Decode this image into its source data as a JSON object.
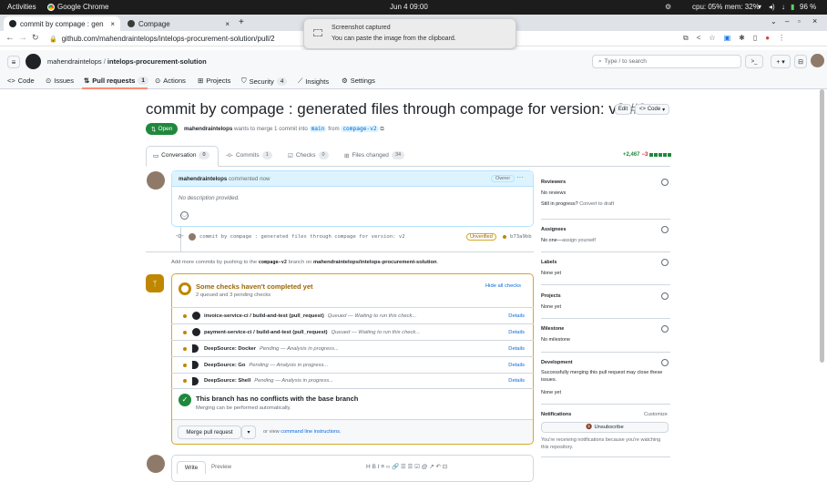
{
  "system_bar": {
    "activities": "Activities",
    "app": "Google Chrome",
    "clock": "Jun 4  09:00",
    "stats": "cpu: 05% mem: 32%",
    "battery": "96 %"
  },
  "browser": {
    "tabs": [
      {
        "title": "commit by compage : gen",
        "active": true
      },
      {
        "title": "Compage",
        "active": false
      }
    ],
    "new_tab": "+",
    "url": "github.com/mahendraintelops/intelops-procurement-solution/pull/2"
  },
  "notification": {
    "title": "Screenshot captured",
    "body": "You can paste the image from the clipboard."
  },
  "github": {
    "breadcrumb_owner": "mahendraintelops",
    "breadcrumb_sep": "/",
    "breadcrumb_repo": "intelops-procurement-solution",
    "search_placeholder": "Type / to search",
    "nav": [
      {
        "label": "Code",
        "count": null
      },
      {
        "label": "Issues",
        "count": null
      },
      {
        "label": "Pull requests",
        "count": "1"
      },
      {
        "label": "Actions",
        "count": null
      },
      {
        "label": "Projects",
        "count": null
      },
      {
        "label": "Security",
        "count": "4"
      },
      {
        "label": "Insights",
        "count": null
      },
      {
        "label": "Settings",
        "count": null
      }
    ]
  },
  "pr": {
    "title": "commit by compage : generated files through compage for version: v2",
    "number": "#2",
    "edit_label": "Edit",
    "code_label": "Code",
    "status": "Open",
    "author": "mahendraintelops",
    "merge_text": "wants to merge 1 commit into",
    "base_branch": "main",
    "from_text": "from",
    "head_branch": "compage-v2",
    "tabs": [
      {
        "label": "Conversation",
        "count": "0"
      },
      {
        "label": "Commits",
        "count": "1"
      },
      {
        "label": "Checks",
        "count": "0"
      },
      {
        "label": "Files changed",
        "count": "34"
      }
    ],
    "diffstat_add": "+2,467",
    "diffstat_del": "−3"
  },
  "comment": {
    "author": "mahendraintelops",
    "meta": "commented now",
    "role": "Owner",
    "more": "···",
    "body": "No description provided."
  },
  "commit_row": {
    "message": "commit by compage : generated files through compage for version: v2",
    "badge": "Unverified",
    "sha": "b73a9bb"
  },
  "hint": {
    "prefix": "Add more commits by pushing to the",
    "branch": "compage-v2",
    "middle": "branch on",
    "repo": "mahendraintelops/intelops-procurement-solution",
    "suffix": "."
  },
  "merge_box": {
    "checks_title": "Some checks haven't completed yet",
    "checks_subtitle": "2 queued and 3 pending checks",
    "hide_label": "Hide all checks",
    "details_label": "Details",
    "checks": [
      {
        "name": "invoice-service-ci / build-and-test (pull_request)",
        "status": "Queued — Waiting to run this check..."
      },
      {
        "name": "payment-service-ci / build-and-test (pull_request)",
        "status": "Queued — Waiting to run this check..."
      },
      {
        "name": "DeepSource: Docker",
        "status": "Pending — Analysis in progress..."
      },
      {
        "name": "DeepSource: Go",
        "status": "Pending — Analysis in progress..."
      },
      {
        "name": "DeepSource: Shell",
        "status": "Pending — Analysis in progress..."
      }
    ],
    "conflict_title": "This branch has no conflicts with the base branch",
    "conflict_subtitle": "Merging can be performed automatically.",
    "merge_button": "Merge pull request",
    "or_view": "or view",
    "cli_link": "command line instructions",
    "cli_end": "."
  },
  "editor": {
    "write_tab": "Write",
    "preview_tab": "Preview",
    "toolbar": "H  B  I  ≡  ‹›  🔗  ☰  ☰  ☑  @  ↗  ↶  ⊡"
  },
  "sidebar": {
    "reviewers": {
      "title": "Reviewers",
      "value": "No reviews",
      "value2_prefix": "Still in progress?",
      "value2_link": "Convert to draft"
    },
    "assignees": {
      "title": "Assignees",
      "value_bold": "No one—",
      "value_link": "assign yourself"
    },
    "labels": {
      "title": "Labels",
      "value": "None yet"
    },
    "projects": {
      "title": "Projects",
      "value": "None yet"
    },
    "milestone": {
      "title": "Milestone",
      "value": "No milestone"
    },
    "development": {
      "title": "Development",
      "value_line1": "Successfully merging this pull request may close these",
      "value_line2": "issues.",
      "value3": "None yet"
    },
    "notifications": {
      "title": "Notifications",
      "customize": "Customize",
      "button": "Unsubscribe",
      "note_line1": "You're receiving notifications because you're watching",
      "note_line2": "this repository."
    }
  },
  "colors": {
    "open_green": "#1f883d",
    "link_blue": "#0969da",
    "pending_yellow": "#bf8700",
    "diff_del_red": "#cf222e"
  }
}
